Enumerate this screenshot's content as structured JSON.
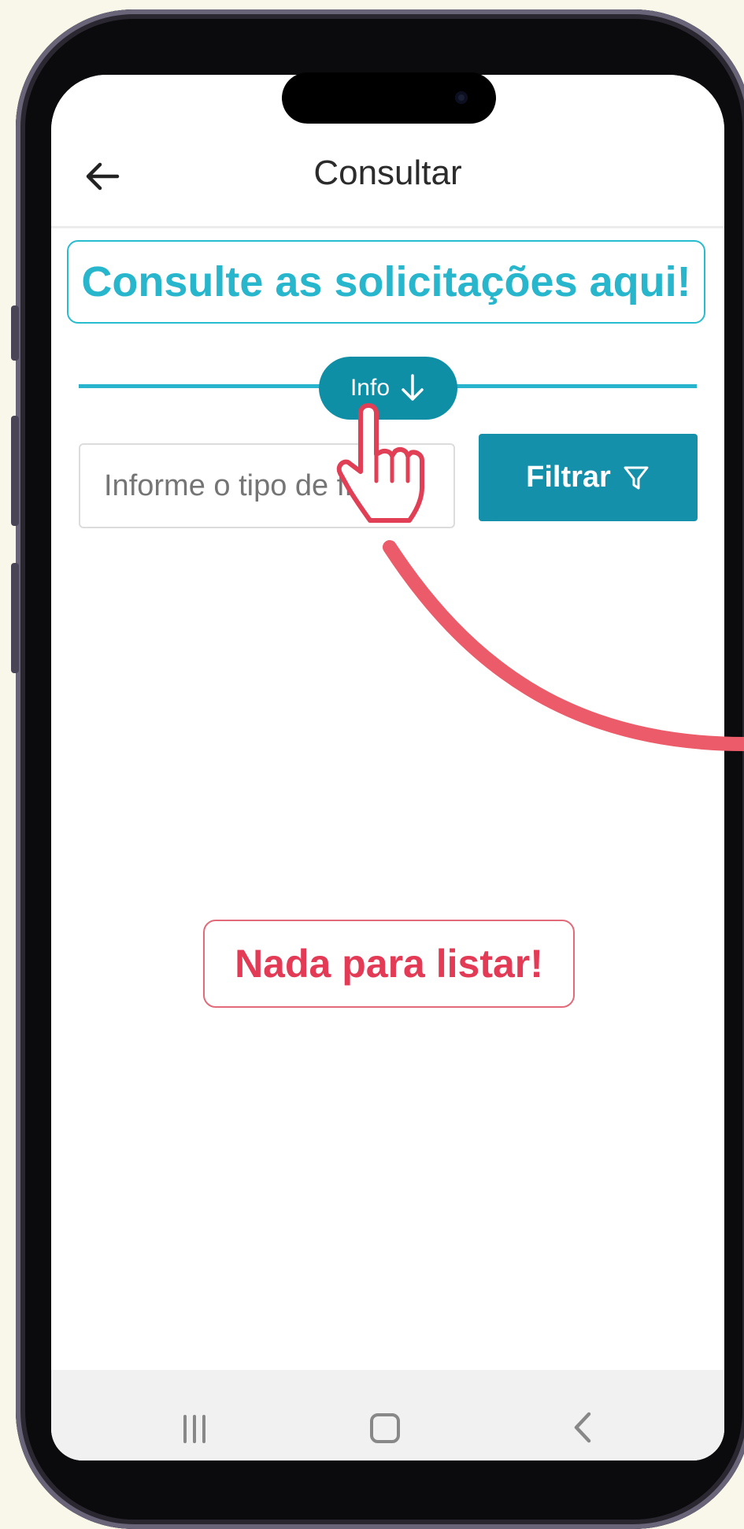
{
  "header": {
    "title": "Consultar",
    "back_icon": "arrow-left-icon"
  },
  "banner": {
    "text": "Consulte as solicitações aqui!"
  },
  "info_toggle": {
    "label": "Info",
    "icon": "arrow-down-icon"
  },
  "filter": {
    "placeholder": "Informe o tipo de filtro",
    "button_label": "Filtrar",
    "button_icon": "funnel-icon"
  },
  "empty_state": {
    "text": "Nada para listar!"
  },
  "system_nav": {
    "recents_icon": "recents-icon",
    "home_icon": "home-icon",
    "back_icon": "chevron-left-icon"
  },
  "colors": {
    "accent": "#27b6cc",
    "primary_button": "#1590aa",
    "empty_state": "#e33a56",
    "annotation": "#ec5b69"
  }
}
